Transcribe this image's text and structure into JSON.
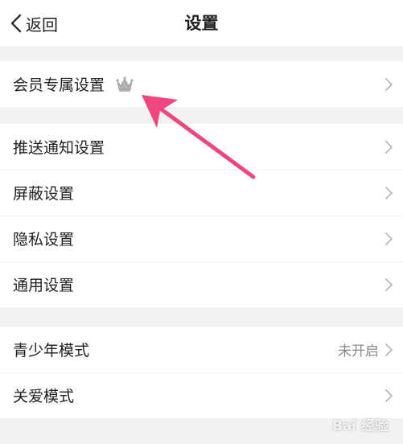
{
  "header": {
    "back_label": "返回",
    "title": "设置"
  },
  "groups": [
    {
      "rows": [
        {
          "label": "会员专属设置",
          "badge_icon": "crown-icon"
        }
      ]
    },
    {
      "rows": [
        {
          "label": "推送通知设置"
        },
        {
          "label": "屏蔽设置"
        },
        {
          "label": "隐私设置"
        },
        {
          "label": "通用设置"
        }
      ]
    },
    {
      "rows": [
        {
          "label": "青少年模式",
          "value": "未开启"
        },
        {
          "label": "关爱模式"
        }
      ]
    }
  ],
  "watermark": "Bai 经验",
  "colors": {
    "background": "#f2f2f4",
    "annotation_arrow": "#f0467f",
    "chevron": "#b9b9b9"
  }
}
